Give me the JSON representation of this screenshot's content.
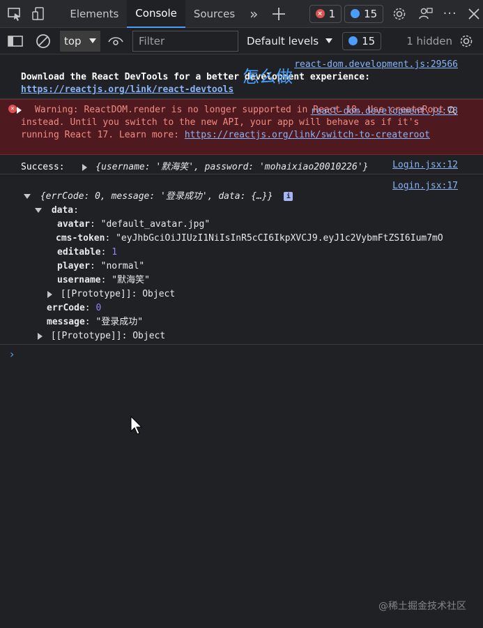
{
  "tabs": {
    "elements": "Elements",
    "console": "Console",
    "sources": "Sources",
    "error_count": "1",
    "message_count": "15"
  },
  "toolbar": {
    "context": "top",
    "filter_placeholder": "Filter",
    "levels": "Default levels",
    "message_count": "15",
    "hidden": "1 hidden"
  },
  "console": {
    "line1": {
      "source": "react-dom.development.js:29566",
      "text_a": "Download the React DevTools for a better development experience: ",
      "link": "https://reactjs.org/link/react-devtools",
      "overlay": "怎么做"
    },
    "warning": {
      "source": "react-dom.development.js:78",
      "text": "Warning: ReactDOM.render is no longer supported in React 18. Use createRoot instead. Until you switch to the new API, your app will behave as if it's running React 17. Learn more: ",
      "link": "https://reactjs.org/link/switch-to-createroot"
    },
    "success": {
      "label": "Success:",
      "source": "Login.jsx:12",
      "obj": "{username: '默海笑', password: 'mohaixiao20010226'}"
    },
    "result": {
      "source": "Login.jsx:17",
      "summary": "{errCode: 0, message: '登录成功', data: {…}}",
      "data_key": "data",
      "avatar_key": "avatar",
      "avatar_val": "\"default_avatar.jpg\"",
      "token_key": "cms-token",
      "token_val": "\"eyJhbGciOiJIUzI1NiIsInR5cCI6IkpXVCJ9.eyJ1c2VybmFtZSI6Ium7mO",
      "editable_key": "editable",
      "editable_val": "1",
      "player_key": "player",
      "player_val": "\"normal\"",
      "username_key": "username",
      "username_val": "\"默海笑\"",
      "proto1": "[[Prototype]]: Object",
      "errcode_key": "errCode",
      "errcode_val": "0",
      "message_key": "message",
      "message_val": "\"登录成功\"",
      "proto2": "[[Prototype]]: Object"
    }
  },
  "watermark": "@稀土掘金技术社区"
}
